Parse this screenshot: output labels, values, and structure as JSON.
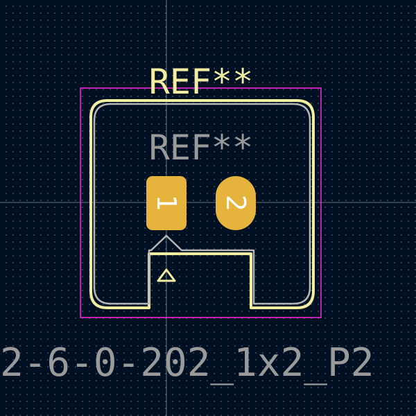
{
  "footprint": {
    "ref_silk": "REF**",
    "ref_fab": "REF**",
    "value_text": "2-6-0-202_1x2_P2",
    "pads": [
      {
        "number": "1",
        "shape": "rect"
      },
      {
        "number": "2",
        "shape": "oval"
      }
    ]
  },
  "colors": {
    "background": "#001023",
    "grid_dot": "#3a4a64",
    "crosshair": "#c8c8c8",
    "silkscreen": "#f2eda1",
    "fab": "#b6b6b6",
    "courtyard": "#ff26e2",
    "pad": "#e6b43c",
    "pad_number": "#ffffff",
    "ref_silk_text": "#f2eda1",
    "ref_fab_text": "#9a9a9a",
    "value_text_color": "#9a9a9a"
  }
}
